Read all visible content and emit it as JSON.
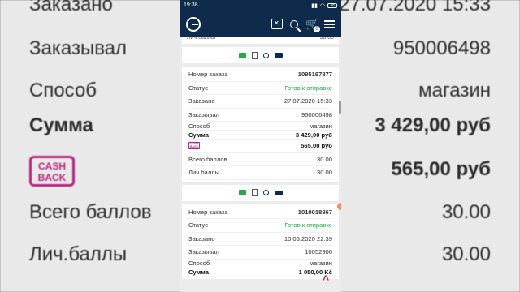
{
  "background": {
    "rows": [
      {
        "label": "Заказано",
        "value": "27.07.2020 15:33"
      },
      {
        "label": "Заказывал",
        "value": "950006498"
      },
      {
        "label": "Способ",
        "value": "магазин"
      },
      {
        "label": "Сумма",
        "value": "3 429,00 руб"
      },
      {
        "label": "",
        "value": "565,00 руб"
      },
      {
        "label": "Всего баллов",
        "value": "30.00"
      },
      {
        "label": "Лич.баллы",
        "value": "30.00"
      }
    ],
    "cashback_badge": "CASH BACK"
  },
  "statusbar": {
    "time": "19:38",
    "battery": "38"
  },
  "appbar": {
    "cart_count": "0"
  },
  "cut_row": {
    "label": "Лич.баллы",
    "value": "30.00"
  },
  "orders": [
    {
      "order_label": "Номер заказа",
      "order_no": "1095197877",
      "status_label": "Статус",
      "status": "Готов к отправке",
      "ordered_label": "Заказано",
      "ordered": "27.07.2020 15:33",
      "customer_label": "Заказывал",
      "customer": "950006498",
      "method_label": "Способ",
      "method": "магазин",
      "sum_label": "Сумма",
      "sum": "3 429,00 руб",
      "cashback": "565,00 руб",
      "total_points_label": "Всего баллов",
      "total_points": "30.00",
      "personal_points_label": "Лич.баллы",
      "personal_points": "30.00"
    },
    {
      "order_label": "Номер заказа",
      "order_no": "1010018867",
      "status_label": "Статус",
      "status": "Готов к отправке",
      "ordered_label": "Заказано",
      "ordered": "10.06.2020 22:39",
      "customer_label": "Заказывал",
      "customer": "10052906",
      "method_label": "Способ",
      "method": "магазин",
      "sum_label": "Сумма",
      "sum": "1 050,00 Kč"
    }
  ],
  "cashback_mini": "CASH BACK",
  "icons": [
    "card-icon",
    "document-icon",
    "search-icon",
    "truck-icon"
  ],
  "colors": {
    "navy": "#0f2b4c",
    "green": "#29a849",
    "magenta": "#b8257f"
  }
}
